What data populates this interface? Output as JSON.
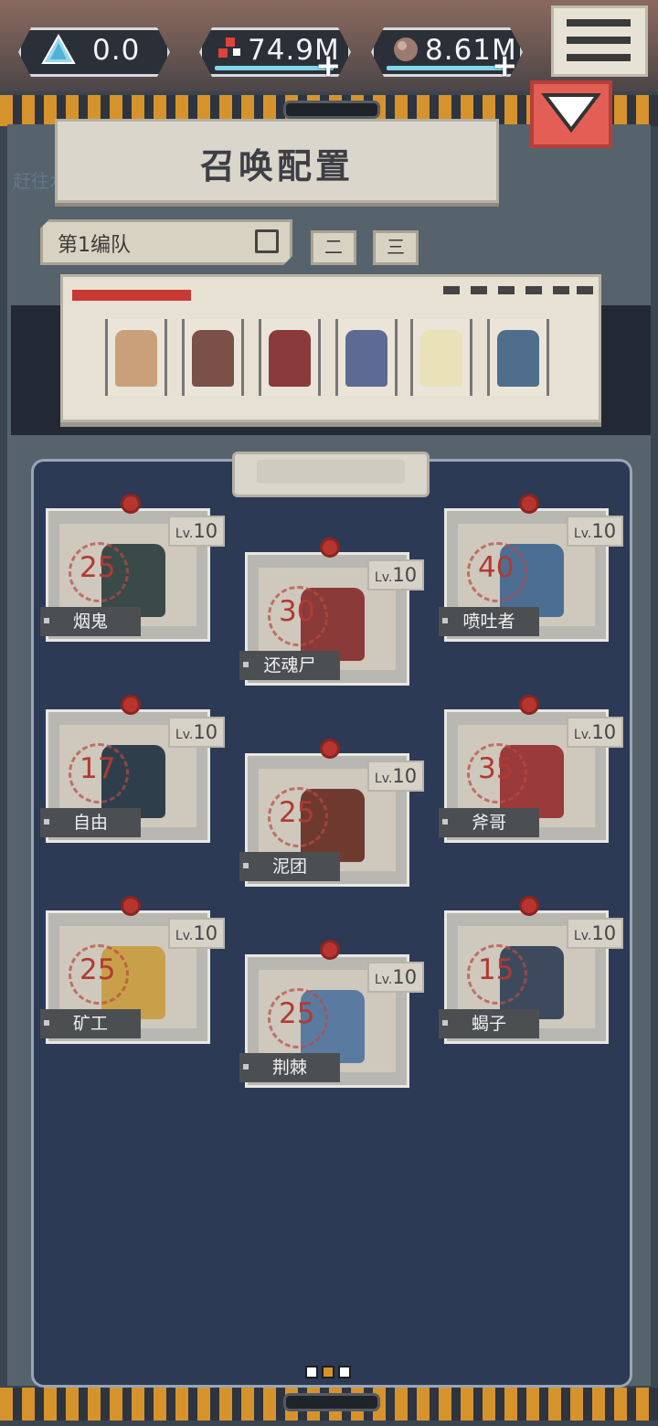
{
  "resources": [
    {
      "name": "crystal-icon",
      "value": "0.0",
      "has_plus": false
    },
    {
      "name": "blood-icon",
      "value": "74.9M",
      "has_plus": true
    },
    {
      "name": "ore-icon",
      "value": "8.61M",
      "has_plus": true
    }
  ],
  "panel": {
    "title": "召唤配置",
    "quest_bg_text": "赶往水牛牧场，阻止背叛！",
    "team_selector": {
      "label": "第1编队"
    },
    "team_tabs": [
      "二",
      "三"
    ]
  },
  "lineup": [
    {
      "name": "lineup-unit-1",
      "color": "#c9a07a"
    },
    {
      "name": "lineup-unit-2",
      "color": "#7a5048"
    },
    {
      "name": "lineup-unit-3",
      "color": "#8a3a3a"
    },
    {
      "name": "lineup-unit-4",
      "color": "#5c6a94"
    },
    {
      "name": "lineup-unit-5",
      "color": "#e9e2b8"
    },
    {
      "name": "lineup-unit-6",
      "color": "#4f6d8c"
    }
  ],
  "cards": [
    {
      "cost": "25",
      "lv": "10",
      "name": "烟鬼",
      "color": "#3a4a48"
    },
    {
      "cost": "30",
      "lv": "10",
      "name": "还魂尸",
      "color": "#8b3a3a"
    },
    {
      "cost": "40",
      "lv": "10",
      "name": "喷吐者",
      "color": "#4d6e93"
    },
    {
      "cost": "17",
      "lv": "10",
      "name": "自由",
      "color": "#2f3e4b"
    },
    {
      "cost": "25",
      "lv": "10",
      "name": "泥团",
      "color": "#6e3a30"
    },
    {
      "cost": "35",
      "lv": "10",
      "name": "斧哥",
      "color": "#9a3a3a"
    },
    {
      "cost": "25",
      "lv": "10",
      "name": "矿工",
      "color": "#c9a04a"
    },
    {
      "cost": "25",
      "lv": "10",
      "name": "荆棘",
      "color": "#5b7aa0"
    },
    {
      "cost": "15",
      "lv": "10",
      "name": "蝎子",
      "color": "#3d4a5e"
    }
  ],
  "lv_prefix": "Lv.",
  "pagination": {
    "total": 3,
    "active": 1
  },
  "colors": {
    "accent_orange": "#d6932c",
    "close_red": "#e35f55",
    "panel_navy": "#2c3a56"
  }
}
